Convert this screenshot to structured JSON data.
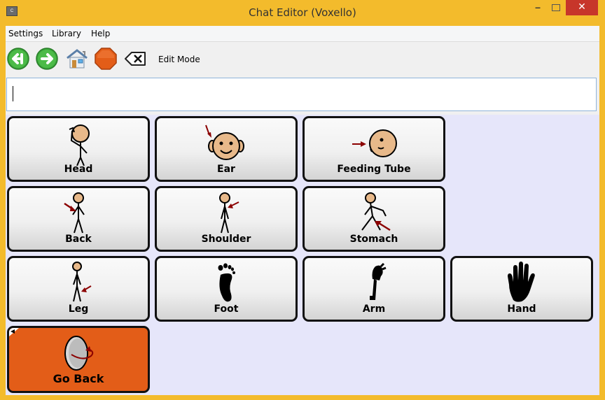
{
  "window": {
    "title": "Chat Editor (Voxello)",
    "close_glyph": "✕",
    "minimize_glyph": "–"
  },
  "menu": {
    "items": [
      "Settings",
      "Library",
      "Help"
    ]
  },
  "toolbar": {
    "buttons": [
      {
        "icon": "back-arrow-icon",
        "color": "#3aa53a"
      },
      {
        "icon": "forward-arrow-icon",
        "color": "#3aa53a"
      },
      {
        "icon": "home-icon"
      },
      {
        "icon": "stop-icon",
        "color": "#e35d18"
      },
      {
        "icon": "clear-text-icon"
      }
    ],
    "edit_mode_label": "Edit Mode"
  },
  "message": {
    "value": ""
  },
  "grid": {
    "background": "#e6e6fa",
    "cells": [
      {
        "label": "Head",
        "icon": "head-figure-icon"
      },
      {
        "label": "Ear",
        "icon": "ear-face-icon"
      },
      {
        "label": "Feeding Tube",
        "icon": "feeding-tube-icon"
      },
      {
        "label": "Back",
        "icon": "back-figure-icon"
      },
      {
        "label": "Shoulder",
        "icon": "shoulder-figure-icon"
      },
      {
        "label": "Stomach",
        "icon": "stomach-figure-icon"
      },
      {
        "label": "Leg",
        "icon": "leg-figure-icon"
      },
      {
        "label": "Foot",
        "icon": "foot-icon"
      },
      {
        "label": "Arm",
        "icon": "arm-icon"
      },
      {
        "label": "Hand",
        "icon": "hand-icon"
      },
      {
        "label": "Go Back",
        "icon": "go-back-icon",
        "color": "#e35d18"
      }
    ]
  }
}
